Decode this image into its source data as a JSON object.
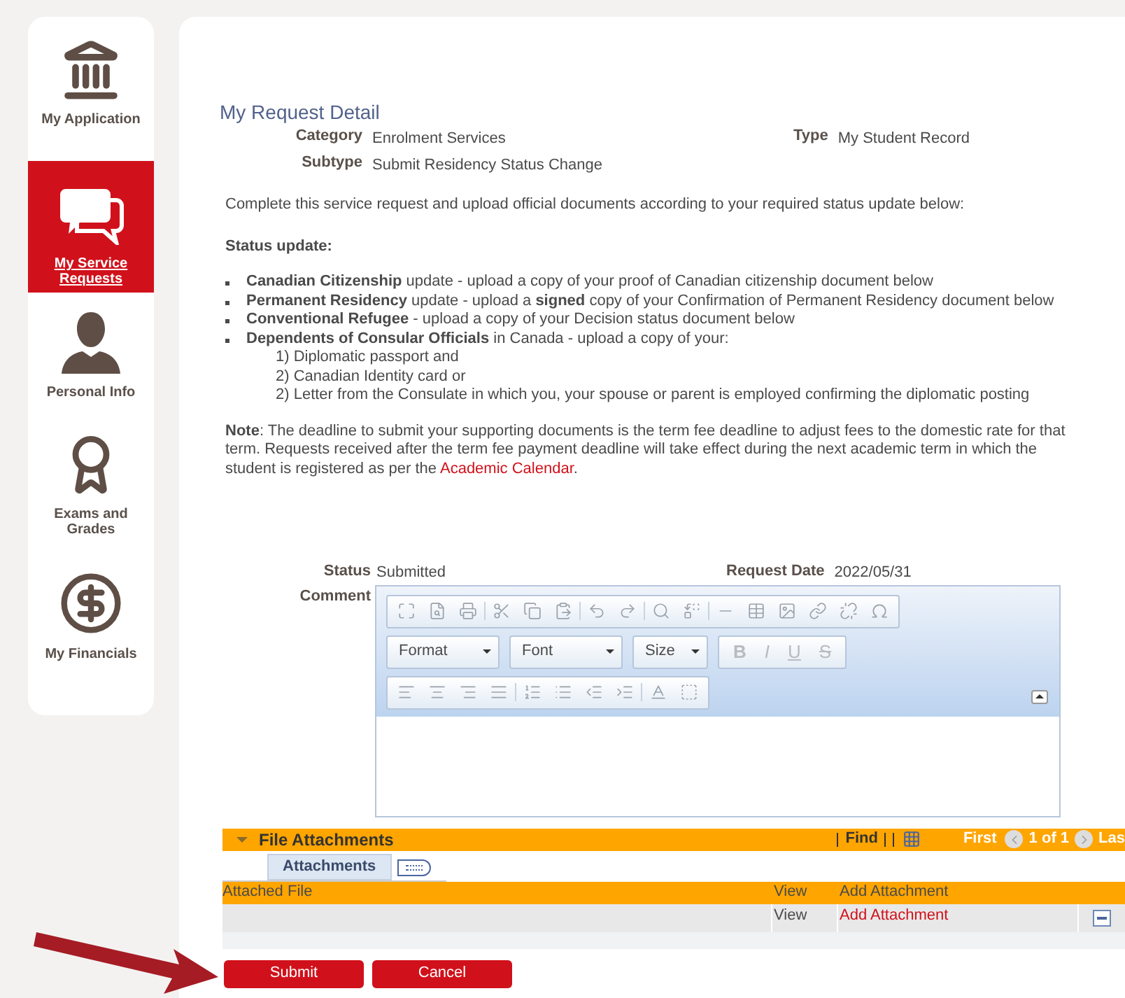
{
  "sidebar": {
    "items": [
      {
        "label": "My Application",
        "kind": "bank",
        "selected": false
      },
      {
        "label": "My Service Requests",
        "kind": "chat",
        "selected": true
      },
      {
        "label": "Personal Info",
        "kind": "person",
        "selected": false
      },
      {
        "label": "Exams and Grades",
        "kind": "award",
        "selected": false
      },
      {
        "label": "My Financials",
        "kind": "dollar",
        "selected": false
      }
    ]
  },
  "request": {
    "title": "My Request Detail",
    "rows": [
      {
        "label": "Category",
        "value": "Enrolment Services",
        "right_label": "Type",
        "right_value": "My Student Record"
      },
      {
        "label": "Subtype",
        "value": "Submit Residency Status Change"
      }
    ],
    "intro": "Complete this service request and upload official documents according to your required status update below:",
    "heading": "Status update:",
    "bullets": [
      "**Canadian Citizenship** update - upload a copy of your proof of Canadian citizenship document below",
      "**Permanent Residency** update - upload a **signed** copy of your Confirmation of Permanent Residency document below",
      "**Conventional Refugee** - upload a copy of your Decision status document below",
      "**Dependents of Consular Officials** in Canada - upload a copy of your:"
    ],
    "sub_items": [
      "1) Diplomatic passport and",
      "2) Canadian Identity card or",
      "2) Letter from the Consulate in which you, your spouse or parent is employed confirming the diplomatic posting"
    ],
    "note": {
      "text": "**Note**: The deadline to submit your supporting documents is the term fee deadline to adjust fees to the domestic rate for that term. Requests received after the term fee payment deadline will take effect during the next academic term in which the student is registered as per the",
      "link": "Academic Calendar",
      "suffix": "."
    }
  },
  "status": {
    "label": "Status",
    "value": "Submitted",
    "date_label": "Request Date",
    "date_value": "2022/05/31",
    "comment_label": "Comment"
  },
  "editor": {
    "dropdowns": [
      "Format",
      "Font",
      "Size"
    ],
    "styles": [
      "B",
      "I",
      "U",
      "S"
    ]
  },
  "attachments": {
    "title": "File Attachments",
    "find": "Find",
    "first": "First",
    "count": "1 of 1",
    "last": "Las",
    "tabs": [
      {
        "label": "Attachments",
        "selected": true
      }
    ],
    "columns": [
      "Attached File",
      "View",
      "Add Attachment"
    ],
    "rows": [
      {
        "view": "View",
        "add": "Add Attachment"
      }
    ]
  },
  "buttons": [
    "Submit",
    "Cancel"
  ]
}
